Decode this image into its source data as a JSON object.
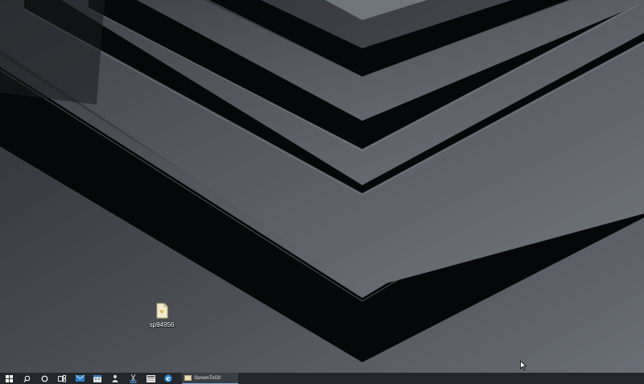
{
  "desktop": {
    "icons": [
      {
        "label": "sp94956",
        "icon": "document-icon"
      }
    ],
    "colors": {
      "background": "#3b3e44",
      "chevron_dark": "#07080a",
      "chevron_light": "#5d6168"
    }
  },
  "taskbar": {
    "start_icon": "windows-logo-icon",
    "pinned": [
      "search-icon",
      "cortana-icon",
      "task-view-icon",
      "mail-icon",
      "calendar-icon",
      "user-icon",
      "scissors-icon",
      "media-icon",
      "edge-icon"
    ],
    "active_app": {
      "label": "ScreenToGif",
      "icon": "screentogif-icon"
    },
    "colors": {
      "background": "#23262b",
      "accent": "#7aa7d6"
    }
  }
}
